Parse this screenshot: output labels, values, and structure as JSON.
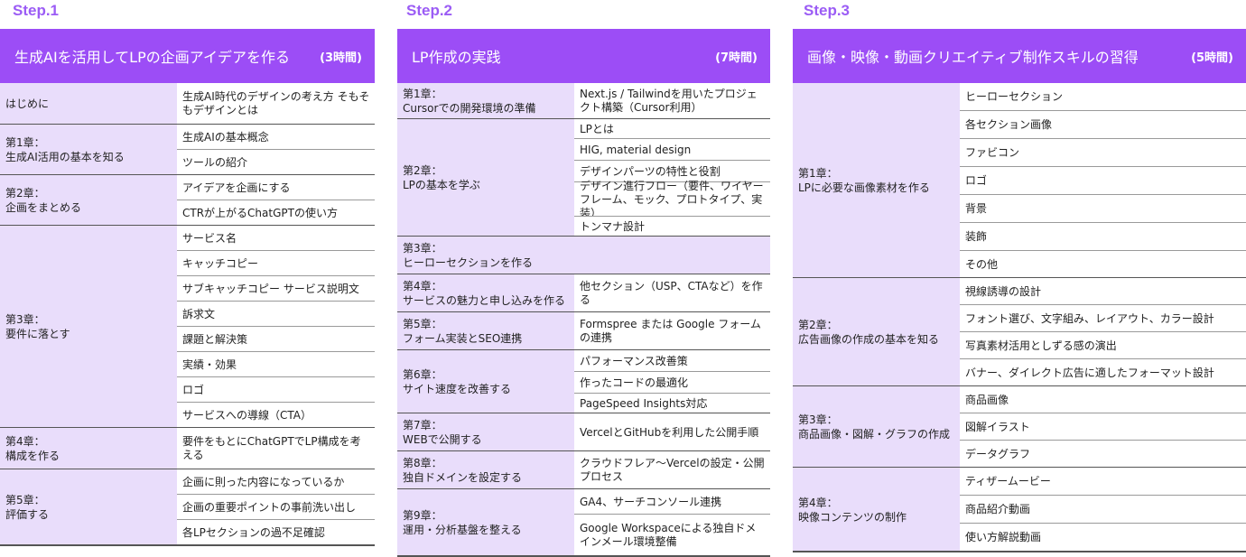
{
  "steps": [
    {
      "label": "Step.1",
      "title": "生成AIを活用してLPの企画アイデアを作る",
      "hours": "(3時間)",
      "chapters": [
        {
          "name": [
            "はじめに"
          ],
          "topics": [
            "生成AI時代のデザインの考え方 そもそもデザインとは"
          ]
        },
        {
          "name": [
            "第1章：",
            "生成AI活用の基本を知る"
          ],
          "topics": [
            "生成AIの基本概念",
            "ツールの紹介"
          ]
        },
        {
          "name": [
            "第2章：",
            "企画をまとめる"
          ],
          "topics": [
            "アイデアを企画にする",
            "CTRが上がるChatGPTの使い方"
          ]
        },
        {
          "name": [
            "第3章：",
            "要件に落とす"
          ],
          "topics": [
            "サービス名",
            "キャッチコピー",
            "サブキャッチコピー サービス説明文",
            "訴求文",
            "課題と解決策",
            "実績・効果",
            "ロゴ",
            "サービスへの導線（CTA）"
          ]
        },
        {
          "name": [
            "第4章：",
            "構成を作る"
          ],
          "topics": [
            "要件をもとにChatGPTでLP構成を考える"
          ]
        },
        {
          "name": [
            "第5章：",
            "評価する"
          ],
          "topics": [
            "企画に則った内容になっているか",
            "企画の重要ポイントの事前洗い出し",
            "各LPセクションの過不足確認"
          ]
        }
      ]
    },
    {
      "label": "Step.2",
      "title": "LP作成の実践",
      "hours": "(7時間)",
      "chapters": [
        {
          "name": [
            "第1章：",
            "Cursorでの開発環境の準備"
          ],
          "topics": [
            "Next.js / Tailwindを用いたプロジェクト構築（Cursor利用）"
          ]
        },
        {
          "name": [
            "第2章：",
            "LPの基本を学ぶ"
          ],
          "topics": [
            "LPとは",
            "HIG, material design",
            "デザインパーツの特性と役割",
            "デザイン進行フロー（要件、ワイヤーフレーム、モック、プロトタイプ、実装）",
            "トンマナ設計"
          ]
        },
        {
          "name": [
            "第3章：",
            "ヒーローセクションを作る"
          ],
          "topics": [
            ""
          ]
        },
        {
          "name": [
            "第4章：",
            "サービスの魅力と申し込みを作る"
          ],
          "topics": [
            "他セクション（USP、CTAなど）を作る"
          ]
        },
        {
          "name": [
            "第5章：",
            "フォーム実装とSEO連携"
          ],
          "topics": [
            "Formspree または Google フォームの連携"
          ]
        },
        {
          "name": [
            "第6章：",
            "サイト速度を改善する"
          ],
          "topics": [
            "パフォーマンス改善策",
            "作ったコードの最適化",
            "PageSpeed Insights対応"
          ]
        },
        {
          "name": [
            "第7章：",
            "WEBで公開する"
          ],
          "topics": [
            "VercelとGitHubを利用した公開手順"
          ]
        },
        {
          "name": [
            "第8章：",
            "独自ドメインを設定する"
          ],
          "topics": [
            "クラウドフレア～Vercelの設定・公開プロセス"
          ]
        },
        {
          "name": [
            "第9章：",
            "運用・分析基盤を整える"
          ],
          "topics": [
            "GA4、サーチコンソール連携",
            "Google Workspaceによる独自ドメインメール環境整備"
          ]
        }
      ]
    },
    {
      "label": "Step.3",
      "title": "画像・映像・動画クリエイティブ制作スキルの習得",
      "hours": "(5時間)",
      "chapters": [
        {
          "name": [
            "第1章：",
            "LPに必要な画像素材を作る"
          ],
          "topics": [
            "ヒーローセクション",
            "各セクション画像",
            "ファビコン",
            "ロゴ",
            "背景",
            "装飾",
            "その他"
          ]
        },
        {
          "name": [
            "第2章：",
            "広告画像の作成の基本を知る"
          ],
          "topics": [
            "視線誘導の設計",
            "フォント選び、文字組み、レイアウト、カラー設計",
            "写真素材活用としずる感の演出",
            "バナー、ダイレクト広告に適したフォーマット設計"
          ]
        },
        {
          "name": [
            "第3章：",
            "商品画像・図解・グラフの作成"
          ],
          "topics": [
            "商品画像",
            "図解イラスト",
            "データグラフ"
          ]
        },
        {
          "name": [
            "第4章：",
            "映像コンテンツの制作"
          ],
          "topics": [
            "ティザームービー",
            "商品紹介動画",
            "使い方解説動画"
          ]
        }
      ]
    }
  ]
}
